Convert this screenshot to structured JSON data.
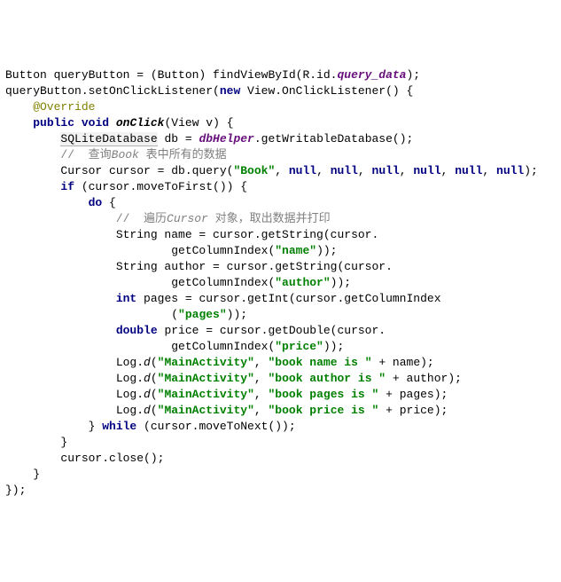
{
  "lines": {
    "l1_a": "Button queryButton = (Button) findViewById(R.id.",
    "l1_b": "query_data",
    "l1_c": ");",
    "l2_a": "queryButton.setOnClickListener(",
    "l2_b": "new",
    "l2_c": " View.OnClickListener() {",
    "l3": "    @Override",
    "l4_a": "    ",
    "l4_b": "public",
    "l4_c": " ",
    "l4_d": "void",
    "l4_e": " ",
    "l4_f": "onClick",
    "l4_g": "(View v) {",
    "l5_a": "        ",
    "l5_b": "SQLiteDatabase",
    "l5_c": " db = ",
    "l5_d": "dbHelper",
    "l5_e": ".getWritableDatabase();",
    "l6_a": "        ",
    "l6_b": "//  查询",
    "l6_c": "Book",
    "l6_d": " 表中所有的数据",
    "l7_a": "        Cursor cursor = db.query(",
    "l7_b": "\"Book\"",
    "l7_c": ", ",
    "l7_d": "null",
    "l7_f": ");",
    "l8_a": "        ",
    "l8_b": "if",
    "l8_c": " (cursor.moveToFirst()) {",
    "l9_a": "            ",
    "l9_b": "do",
    "l9_c": " {",
    "l10_a": "                ",
    "l10_b": "//  遍历",
    "l10_c": "Cursor",
    "l10_d": " 对象，取出数据并打印",
    "l11": "                String name = cursor.getString(cursor.",
    "l12_a": "                        getColumnIndex(",
    "l12_b": "\"name\"",
    "l12_c": "));",
    "l13": "                String author = cursor.getString(cursor.",
    "l14_a": "                        getColumnIndex(",
    "l14_b": "\"author\"",
    "l14_c": "));",
    "l15_a": "                ",
    "l15_b": "int",
    "l15_c": " pages = cursor.getInt(cursor.getColumnIndex",
    "l16_a": "                        (",
    "l16_b": "\"pages\"",
    "l16_c": "));",
    "l17_a": "                ",
    "l17_b": "double",
    "l17_c": " price = cursor.getDouble(cursor.",
    "l18_a": "                        getColumnIndex(",
    "l18_b": "\"price\"",
    "l18_c": "));",
    "l19_a": "                Log.",
    "l19_b": "d",
    "l19_c": "(",
    "l19_d": "\"MainActivity\"",
    "l19_e": ", ",
    "l19_f": "\"book name is \"",
    "l19_g": " + name);",
    "l20_a": "                Log.",
    "l20_b": "d",
    "l20_c": "(",
    "l20_d": "\"MainActivity\"",
    "l20_e": ", ",
    "l20_f": "\"book author is \"",
    "l20_g": " + author);",
    "l21_a": "                Log.",
    "l21_b": "d",
    "l21_c": "(",
    "l21_d": "\"MainActivity\"",
    "l21_e": ", ",
    "l21_f": "\"book pages is \"",
    "l21_g": " + pages);",
    "l22_a": "                Log.",
    "l22_b": "d",
    "l22_c": "(",
    "l22_d": "\"MainActivity\"",
    "l22_e": ", ",
    "l22_f": "\"book price is \"",
    "l22_g": " + price);",
    "l23_a": "            } ",
    "l23_b": "while",
    "l23_c": " (cursor.moveToNext());",
    "l24": "        }",
    "l25": "        cursor.close();",
    "l26": "    }",
    "l27": "});"
  }
}
